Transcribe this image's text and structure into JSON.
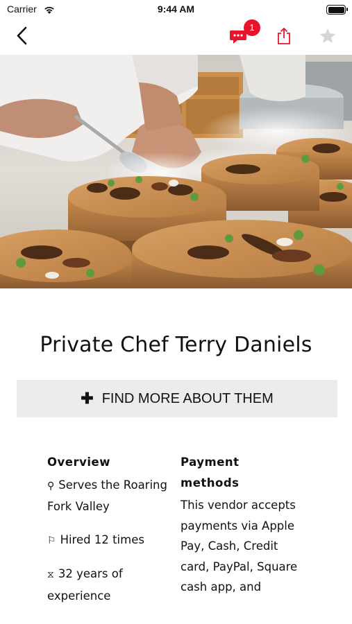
{
  "status_bar": {
    "carrier": "Carrier",
    "time": "9:44 AM",
    "battery_level": 1.0
  },
  "nav": {
    "back_icon": "chevron-left-icon",
    "chat_icon": "chat-bubble-icon",
    "chat_badge": "1",
    "share_icon": "share-icon",
    "favorite_icon": "star-icon",
    "badge_color": "#e8142b",
    "star_color": "#d6d6d6",
    "share_color": "#e8142b"
  },
  "hero": {
    "image_alt": "plated dishes on wooden slabs with a chef garnishing"
  },
  "profile": {
    "name": "Private Chef Terry Daniels",
    "find_more_label": "FIND MORE ABOUT THEM"
  },
  "overview": {
    "heading": "Overview",
    "items": [
      {
        "icon": "location-pin-icon",
        "text": "Serves the Roaring Fork Valley"
      },
      {
        "icon": "flag-icon",
        "text": "Hired 12 times"
      },
      {
        "icon": "hourglass-icon",
        "text": "32 years of experience"
      }
    ]
  },
  "payment": {
    "heading": "Payment methods",
    "text": "This vendor accepts payments via Apple Pay, Cash, Credit card, PayPal, Square cash app, and"
  }
}
